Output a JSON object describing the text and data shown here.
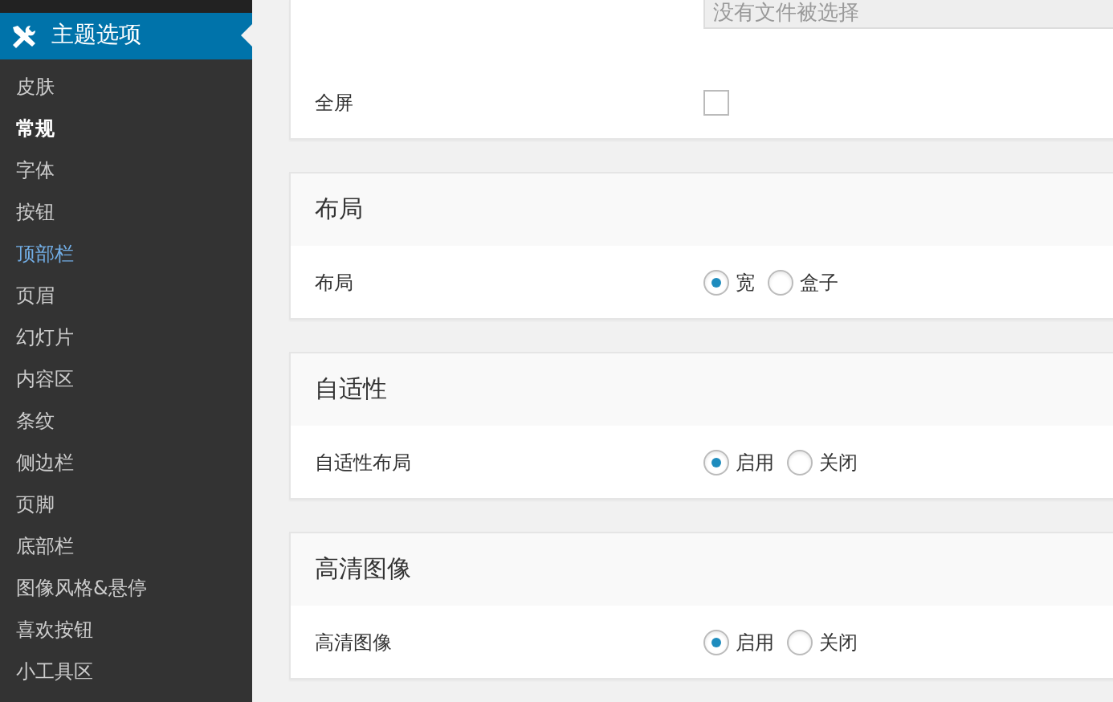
{
  "sidebar": {
    "header": {
      "title": "主题选项"
    },
    "items": [
      {
        "label": "皮肤",
        "selected": false,
        "hovered": false
      },
      {
        "label": "常规",
        "selected": true,
        "hovered": false
      },
      {
        "label": "字体",
        "selected": false,
        "hovered": false
      },
      {
        "label": "按钮",
        "selected": false,
        "hovered": false
      },
      {
        "label": "顶部栏",
        "selected": false,
        "hovered": true
      },
      {
        "label": "页眉",
        "selected": false,
        "hovered": false
      },
      {
        "label": "幻灯片",
        "selected": false,
        "hovered": false
      },
      {
        "label": "内容区",
        "selected": false,
        "hovered": false
      },
      {
        "label": "条纹",
        "selected": false,
        "hovered": false
      },
      {
        "label": "侧边栏",
        "selected": false,
        "hovered": false
      },
      {
        "label": "页脚",
        "selected": false,
        "hovered": false
      },
      {
        "label": "底部栏",
        "selected": false,
        "hovered": false
      },
      {
        "label": "图像风格&悬停",
        "selected": false,
        "hovered": false
      },
      {
        "label": "喜欢按钮",
        "selected": false,
        "hovered": false
      },
      {
        "label": "小工具区",
        "selected": false,
        "hovered": false
      }
    ]
  },
  "sections": [
    {
      "rows": [
        {
          "kind": "file",
          "placeholder": "没有文件被选择"
        },
        {
          "kind": "checkbox",
          "label": "全屏",
          "checked": false
        }
      ]
    },
    {
      "title": "布局",
      "rows": [
        {
          "kind": "radio",
          "label": "布局",
          "options": [
            {
              "label": "宽",
              "selected": true
            },
            {
              "label": "盒子",
              "selected": false
            }
          ]
        }
      ]
    },
    {
      "title": "自适性",
      "rows": [
        {
          "kind": "radio",
          "label": "自适性布局",
          "options": [
            {
              "label": "启用",
              "selected": true
            },
            {
              "label": "关闭",
              "selected": false
            }
          ]
        }
      ]
    },
    {
      "title": "高清图像",
      "rows": [
        {
          "kind": "radio",
          "label": "高清图像",
          "options": [
            {
              "label": "启用",
              "selected": true
            },
            {
              "label": "关闭",
              "selected": false
            }
          ]
        }
      ]
    }
  ]
}
